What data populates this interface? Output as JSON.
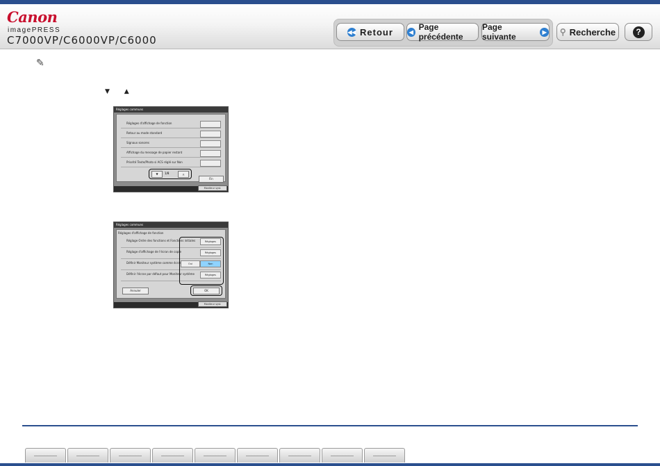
{
  "header": {
    "brand": "Canon",
    "product": "imagePRESS",
    "model": "C7000VP/C6000VP/C6000"
  },
  "nav": {
    "back_label": "Retour",
    "prev_label": "Page précédente",
    "next_label": "Page suivante",
    "search_label": "Recherche",
    "help_label": "?"
  },
  "content": {
    "note_icon": "pencil-note-icon",
    "arrow_down": "▼",
    "arrow_up": "▲"
  },
  "screen1": {
    "title": "Réglages communs",
    "rows": [
      {
        "label": "Réglages d'affichage de fonction",
        "value": ""
      },
      {
        "label": "Retour au mode standard",
        "value": ""
      },
      {
        "label": "Signaux sonores",
        "value": ""
      },
      {
        "label": "Affichage du message de papier restant",
        "value": ""
      },
      {
        "label": "Priorité Texte/Photo si ACS réglé sur Non",
        "value": ""
      }
    ],
    "page_indicator": "1/8",
    "end_button": "Fin",
    "monitor_button": "Moniteur syst."
  },
  "screen2": {
    "title": "Réglages communs",
    "subtitle": "Réglages d'affichage de fonction",
    "rows": [
      {
        "label": "Réglage Ordre des fonctions et Fonctions initiales",
        "value": "Réglages"
      },
      {
        "label": "Réglage d'affichage de l'écran de copie",
        "value": "Réglages"
      },
      {
        "label": "Définir Moniteur système comme écran par défaut",
        "value": "Non"
      },
      {
        "label": "Définir l'écran par défaut pour Moniteur système",
        "value": "Réglages"
      }
    ],
    "yes_button": "Oui",
    "cancel_button": "Annuler",
    "ok_button": "OK",
    "monitor_button": "Moniteur syst."
  },
  "colors": {
    "accent": "#2a4f8e",
    "brand_red": "#c8102e",
    "nav_blue": "#2e7fd0"
  }
}
